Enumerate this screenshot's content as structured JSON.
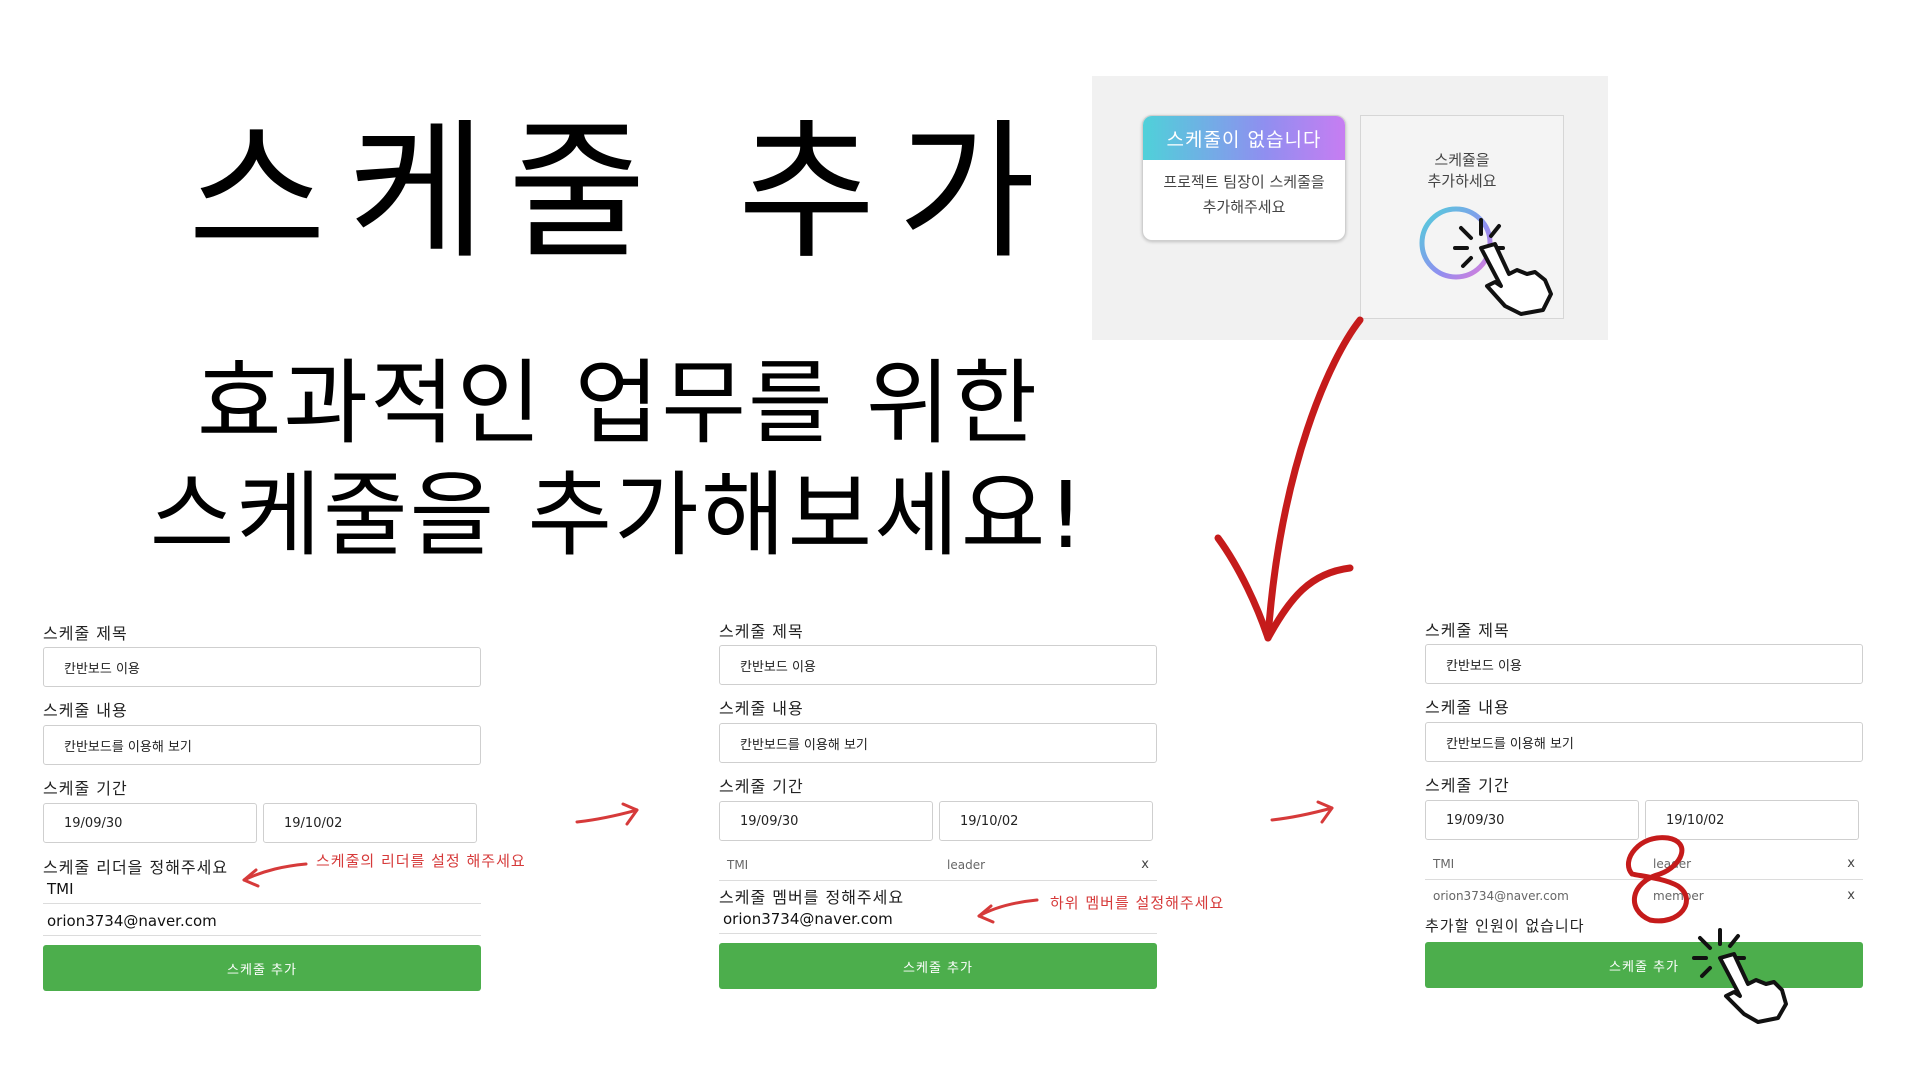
{
  "hero": {
    "title": "스케줄 추가",
    "subtitle_line1": "효과적인 업무를 위한",
    "subtitle_line2": "스케줄을 추가해보세요!"
  },
  "preview": {
    "empty_card_title": "스케줄이 없습니다",
    "empty_card_body": "프로젝트 팀장이 스케줄을 추가해주세요",
    "add_card_line1": "스케쥴을",
    "add_card_line2": "추가하세요"
  },
  "form1": {
    "title_label": "스케줄 제목",
    "title_value": "칸반보드 이용",
    "content_label": "스케줄 내용",
    "content_value": "칸반보드를 이용해 보기",
    "period_label": "스케줄 기간",
    "start_date": "19/09/30",
    "end_date": "19/10/02",
    "leader_label": "스케줄 리더을 정해주세요",
    "leader_option": "TMI",
    "email_option": "orion3734@naver.com",
    "submit": "스케줄 추가",
    "annotation": "스케줄의 리더를 설정 해주세요"
  },
  "form2": {
    "title_label": "스케줄 제목",
    "title_value": "칸반보드 이용",
    "content_label": "스케줄 내용",
    "content_value": "칸반보드를 이용해 보기",
    "period_label": "스케줄 기간",
    "start_date": "19/09/30",
    "end_date": "19/10/02",
    "member_name": "TMI",
    "member_role": "leader",
    "remove": "x",
    "member_label": "스케줄 멤버를 정해주세요",
    "email_option": "orion3734@naver.com",
    "submit": "스케줄 추가",
    "annotation": "하위 멤버를 설정해주세요"
  },
  "form3": {
    "title_label": "스케줄 제목",
    "title_value": "칸반보드 이용",
    "content_label": "스케줄 내용",
    "content_value": "칸반보드를 이용해 보기",
    "period_label": "스케줄 기간",
    "start_date": "19/09/30",
    "end_date": "19/10/02",
    "member1_name": "TMI",
    "member1_role": "leader",
    "member2_name": "orion3734@naver.com",
    "member2_role": "member",
    "remove": "x",
    "no_more": "추가할 인원이 없습니다",
    "submit": "스케줄 추가"
  },
  "colors": {
    "accent_green": "#4cae4c",
    "annotation_red": "#d63a3a",
    "gradient_start": "#4fd1d9",
    "gradient_end": "#c77df2"
  },
  "icons": [
    "plus-circle-icon",
    "pointer-hand-icon",
    "red-arrow-icon"
  ]
}
